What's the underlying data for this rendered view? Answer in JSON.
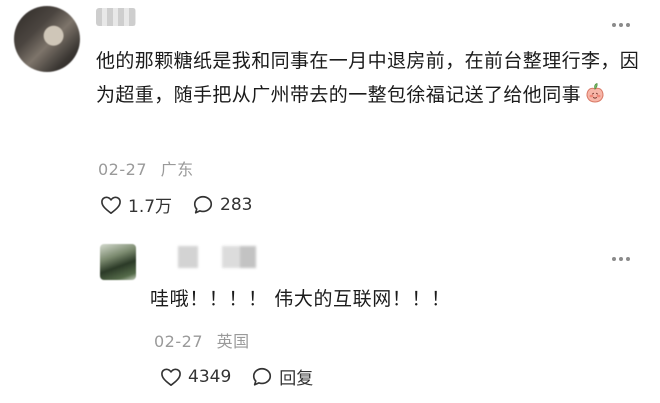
{
  "comment": {
    "text": "他的那颗糖纸是我和同事在一月中退房前，在前台整理行李，因为超重，随手把从广州带去的一整包徐福记送了给他同事",
    "emoji_icon": "peach-blush-emoji",
    "date": "02-27",
    "location": "广东",
    "likes": "1.7万",
    "comments": "283"
  },
  "reply": {
    "text": "哇哦！！！！ 伟大的互联网！！！",
    "date": "02-27",
    "location": "英国",
    "likes": "4349",
    "reply_label": "回复"
  },
  "icons": {
    "like": "heart-outline-icon",
    "comment": "speech-bubble-icon",
    "more": "more-dots-icon"
  }
}
